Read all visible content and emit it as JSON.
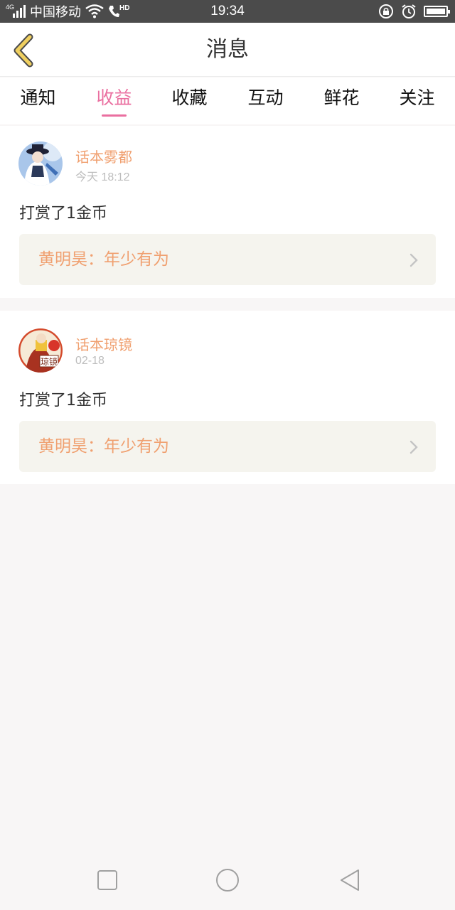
{
  "status_bar": {
    "network": "4G",
    "carrier": "中国移动",
    "call_badge": "HD",
    "time": "19:34",
    "icons": [
      "signal-icon",
      "wifi-icon",
      "phone-hd-icon",
      "rotation-lock-icon",
      "alarm-icon",
      "battery-icon"
    ],
    "battery_level": 1.0
  },
  "header": {
    "title": "消息",
    "back_icon": "chevron-left-icon"
  },
  "tabs": [
    {
      "label": "通知",
      "active": false
    },
    {
      "label": "收益",
      "active": true
    },
    {
      "label": "收藏",
      "active": false
    },
    {
      "label": "互动",
      "active": false
    },
    {
      "label": "鲜花",
      "active": false
    },
    {
      "label": "关注",
      "active": false
    }
  ],
  "messages": [
    {
      "sender": "话本雾都",
      "time": "今天 18:12",
      "action": "打赏了1金币",
      "reference": "黄明昊：年少有为",
      "avatar_icon": "avatar-image"
    },
    {
      "sender": "话本琼镜",
      "time": "02-18",
      "action": "打赏了1金币",
      "reference": "黄明昊：年少有为",
      "avatar_icon": "avatar-image",
      "avatar_text": "琼镜"
    }
  ],
  "colors": {
    "accent": "#ea6fa0",
    "sender": "#f0a070",
    "status_bar": "#4b4b4b",
    "reference_bg": "#f5f4ee",
    "back_arrow": "#f0d060"
  },
  "nav_bar": {
    "icons": [
      "recents-square-icon",
      "home-circle-icon",
      "back-triangle-icon"
    ]
  }
}
